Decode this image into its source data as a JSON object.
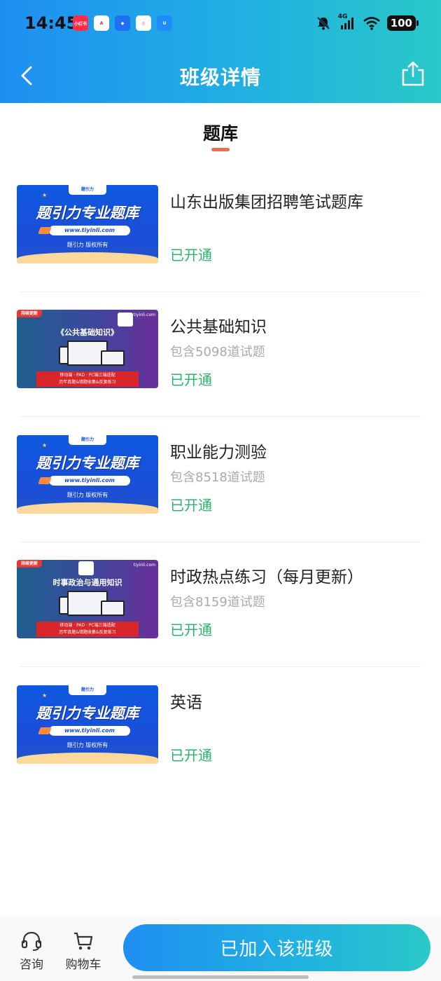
{
  "status_bar": {
    "time": "14:45",
    "network": "4G",
    "battery": "100",
    "app_icons": [
      "小红书",
      "A",
      "◆",
      "◎",
      "U"
    ]
  },
  "nav": {
    "title": "班级详情"
  },
  "section": {
    "title": "题库"
  },
  "thumb_a": {
    "brand": "题引力",
    "title": "题引力专业题库",
    "url": "www.tiyinli.com",
    "copyright": "题引力 版权所有"
  },
  "thumb_b": {
    "tag": "持续更新",
    "site": "tiyinli.com",
    "band_line1": "移动端 · PAD · PC端三端适配",
    "band_line2": "历年真题&错题收集&反复练习"
  },
  "items": [
    {
      "title": "山东出版集团招聘笔试题库",
      "subtitle": "",
      "status": "已开通",
      "thumb": "a"
    },
    {
      "title": "公共基础知识",
      "subtitle": "包含5098道试题",
      "status": "已开通",
      "thumb": "b",
      "thumb_title": "《公共基础知识》"
    },
    {
      "title": "职业能力测验",
      "subtitle": "包含8518道试题",
      "status": "已开通",
      "thumb": "a"
    },
    {
      "title": "时政热点练习（每月更新）",
      "subtitle": "包含8159道试题",
      "status": "已开通",
      "thumb": "b",
      "thumb_title": "时事政治与通用知识"
    },
    {
      "title": "英语",
      "subtitle": "",
      "status": "已开通",
      "thumb": "a"
    }
  ],
  "bottom_bar": {
    "consult_label": "咨询",
    "cart_label": "购物车",
    "join_button": "已加入该班级"
  },
  "colors": {
    "accent_gradient_start": "#1e8ff2",
    "accent_gradient_end": "#2ac8c8",
    "status_green": "#2bb36b",
    "tab_underline": "#f06a4c"
  }
}
